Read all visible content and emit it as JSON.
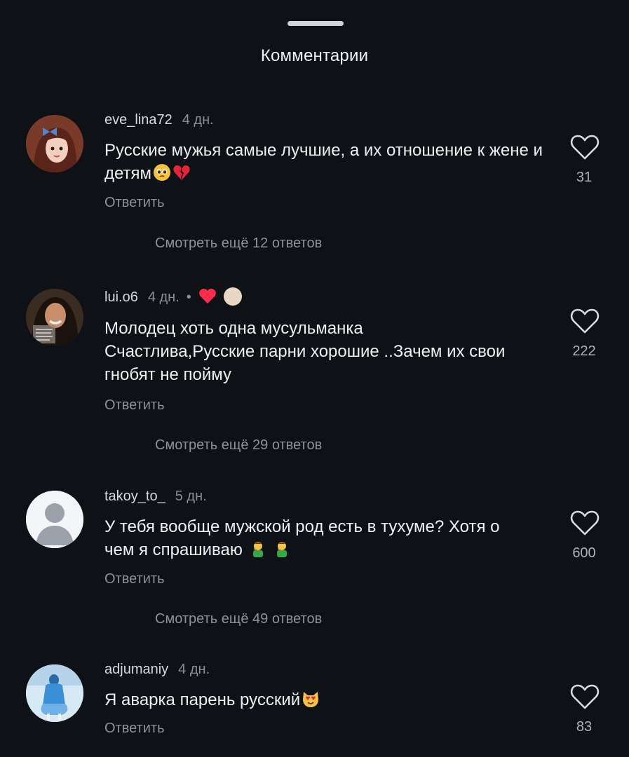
{
  "sheet": {
    "title": "Комментарии"
  },
  "comments": [
    {
      "username": "eve_lina72",
      "time": "4 дн.",
      "text": "Русские мужья самые лучшие, а их отношение к жене и детям",
      "reply_label": "Ответить",
      "likes": "31",
      "more_replies": "Смотреть ещё 12 ответов",
      "emojis": [
        "pleading-face-emoji",
        "broken-heart-emoji"
      ]
    },
    {
      "username": "lui.o6",
      "time": "4 дн.",
      "text_line1": "Молодец хоть одна мусульманка",
      "text_line2": "Счастлива,Русские парни хорошие ..Зачем их свои",
      "text_line3": "гнобят не пойму",
      "reply_label": "Ответить",
      "likes": "222",
      "more_replies": "Смотреть ещё 29 ответов",
      "badges": [
        "red-heart-icon",
        "author-avatar-dot"
      ]
    },
    {
      "username": "takoy_to_",
      "time": "5 дн.",
      "text_line1": "У тебя вообще мужской род есть в тухуме? Хотя о",
      "text_line2": "чем я спрашиваю",
      "reply_label": "Ответить",
      "likes": "600",
      "more_replies": "Смотреть ещё 49 ответов",
      "emojis": [
        "man-facepalming-emoji",
        "man-facepalming-emoji"
      ]
    },
    {
      "username": "adjumaniy",
      "time": "4 дн.",
      "text": "Я аварка парень русский",
      "reply_label": "Ответить",
      "likes": "83",
      "emojis": [
        "heart-eyes-cat-emoji"
      ]
    }
  ],
  "colors": {
    "background": "#0e1116",
    "text": "#eef0f2",
    "secondary": "#8d9299",
    "like_outline": "#d9dbde"
  }
}
